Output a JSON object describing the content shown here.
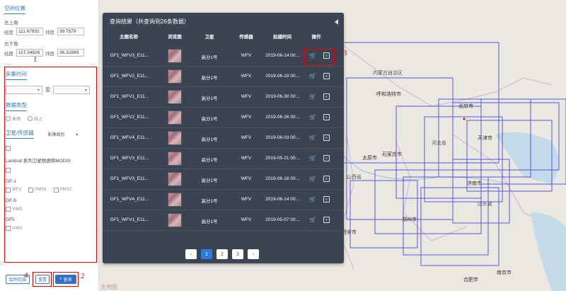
{
  "left": {
    "spatial_title": "空间位置",
    "top_left_label": "左上角",
    "bottom_right_label": "右下角",
    "lon_label": "经度",
    "lat_label": "纬度",
    "tl_lon": "111.67831",
    "tl_lat": "39.7879",
    "br_lon": "117.34826",
    "br_lat": "36.32889",
    "time_title": "采集时间",
    "to_label": "至",
    "datatype_title": "数据类型",
    "local_label": "本地",
    "online_label": "线上",
    "sensor_title": "卫星/传感器",
    "level_label": "影像级别",
    "landsat_label": "Landsat 系列卫星数据和MODIS",
    "gf1_label": "GF-1",
    "gf1_opts": [
      "WFV",
      "PMS1",
      "PMS2"
    ],
    "gf5_label": "GF-5",
    "gf5_opt": "VIMS",
    "gf5b_label": "GF5",
    "gf5b_opt": "VIMS",
    "draw_button": "绘制范围",
    "reset_button": "重置",
    "query_button": "查询"
  },
  "results": {
    "title": "查询结果（共查询到26条数据）",
    "headers": [
      "主题名称",
      "浏览图",
      "卫星",
      "传感器",
      "拍摄时间",
      "操作"
    ],
    "rows": [
      {
        "name": "GF1_WFV3_E11...",
        "sat": "高分1号",
        "sensor": "WFV",
        "time": "2019-06-14 00:..."
      },
      {
        "name": "GF1_WFV2_E11...",
        "sat": "高分1号",
        "sensor": "WFV",
        "time": "2019-06-18 00:..."
      },
      {
        "name": "GF1_WFV1_E11...",
        "sat": "高分1号",
        "sensor": "WFV",
        "time": "2019-06-30 00:..."
      },
      {
        "name": "GF1_WFV2_E11...",
        "sat": "高分1号",
        "sensor": "WFV",
        "time": "2019-06-26 00:..."
      },
      {
        "name": "GF1_WFV4_E11...",
        "sat": "高分1号",
        "sensor": "WFV",
        "time": "2019-06-03 00:..."
      },
      {
        "name": "GF1_WFV3_E11...",
        "sat": "高分1号",
        "sensor": "WFV",
        "time": "2019-05-21 00:..."
      },
      {
        "name": "GF1_WFV3_E11...",
        "sat": "高分1号",
        "sensor": "WFV",
        "time": "2019-06-18 00:..."
      },
      {
        "name": "GF1_WFV4_E11...",
        "sat": "高分1号",
        "sensor": "WFV",
        "time": "2019-06-14 00:..."
      },
      {
        "name": "GF1_WFV1_E11...",
        "sat": "高分1号",
        "sensor": "WFV",
        "time": "2019-05-07 00:..."
      }
    ],
    "pages": [
      "1",
      "2",
      "3"
    ],
    "prev": "‹",
    "next": "›"
  },
  "annotations": [
    "1",
    "2",
    "3",
    "4"
  ],
  "map_labels": [
    "内蒙古自治区",
    "呼和浩特市",
    "北京市",
    "天津市",
    "太原市",
    "石家庄市",
    "河北省",
    "济南市",
    "山东省",
    "郑州市",
    "西安市",
    "合肥市",
    "南京市",
    "山西省"
  ],
  "colors": {
    "accent": "#2d6fc4",
    "panel_bg": "#3a4452",
    "annotation": "#e00000",
    "footprint": "#3b3fe0"
  }
}
